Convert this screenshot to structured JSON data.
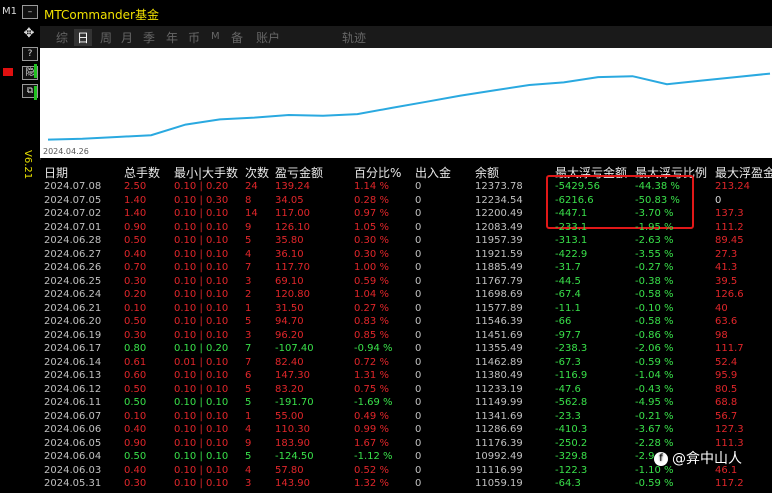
{
  "window": {
    "title": "MTCommander基金",
    "timeframe": "M1",
    "version": "V6.21"
  },
  "tabs": [
    {
      "label": "综"
    },
    {
      "label": "日",
      "active": true
    },
    {
      "label": "周"
    },
    {
      "label": "月"
    },
    {
      "label": "季"
    },
    {
      "label": "年"
    },
    {
      "label": "币"
    },
    {
      "label": "M"
    },
    {
      "label": "备"
    },
    {
      "label": "账户"
    },
    {
      "label": "轨迹"
    }
  ],
  "chart_data": {
    "type": "line",
    "start_label": "2024.04.26",
    "series": [
      {
        "values": [
          5,
          6,
          8,
          10,
          22,
          28,
          30,
          33,
          32,
          34,
          41,
          48,
          55,
          61,
          67,
          70,
          76,
          77,
          68,
          72,
          76,
          80
        ]
      }
    ],
    "ylim": [
      0,
      100
    ],
    "colors": {
      "line": "#2aa9e0"
    }
  },
  "table": {
    "headers": [
      "日期",
      "总手数",
      "最小|大手数",
      "次数",
      "盈亏金额",
      "百分比%",
      "出入金",
      "余额",
      "最大浮亏金额",
      "最大浮亏比例",
      "最大浮盈金额"
    ],
    "rows": [
      {
        "date": "2024.07.08",
        "lots": "2.50",
        "minmax": "0.10 | 0.20",
        "count": "24",
        "pl": "139.24",
        "pct": "1.14 %",
        "io": "0",
        "balance": "12373.78",
        "fl": "-5429.56",
        "flp": "-44.38 %",
        "fp": "213.24",
        "pos": true
      },
      {
        "date": "2024.07.05",
        "lots": "1.40",
        "minmax": "0.10 | 0.30",
        "count": "8",
        "pl": "34.05",
        "pct": "0.28 %",
        "io": "0",
        "balance": "12234.54",
        "fl": "-6216.6",
        "flp": "-50.83 %",
        "fp": "0",
        "pos": true
      },
      {
        "date": "2024.07.02",
        "lots": "1.40",
        "minmax": "0.10 | 0.10",
        "count": "14",
        "pl": "117.00",
        "pct": "0.97 %",
        "io": "0",
        "balance": "12200.49",
        "fl": "-447.1",
        "flp": "-3.70 %",
        "fp": "137.3",
        "pos": true
      },
      {
        "date": "2024.07.01",
        "lots": "0.90",
        "minmax": "0.10 | 0.10",
        "count": "9",
        "pl": "126.10",
        "pct": "1.05 %",
        "io": "0",
        "balance": "12083.49",
        "fl": "-233.1",
        "flp": "-1.95 %",
        "fp": "111.2",
        "pos": true
      },
      {
        "date": "2024.06.28",
        "lots": "0.50",
        "minmax": "0.10 | 0.10",
        "count": "5",
        "pl": "35.80",
        "pct": "0.30 %",
        "io": "0",
        "balance": "11957.39",
        "fl": "-313.1",
        "flp": "-2.63 %",
        "fp": "89.45",
        "pos": true
      },
      {
        "date": "2024.06.27",
        "lots": "0.40",
        "minmax": "0.10 | 0.10",
        "count": "4",
        "pl": "36.10",
        "pct": "0.30 %",
        "io": "0",
        "balance": "11921.59",
        "fl": "-422.9",
        "flp": "-3.55 %",
        "fp": "27.3",
        "pos": true
      },
      {
        "date": "2024.06.26",
        "lots": "0.70",
        "minmax": "0.10 | 0.10",
        "count": "7",
        "pl": "117.70",
        "pct": "1.00 %",
        "io": "0",
        "balance": "11885.49",
        "fl": "-31.7",
        "flp": "-0.27 %",
        "fp": "41.3",
        "pos": true
      },
      {
        "date": "2024.06.25",
        "lots": "0.30",
        "minmax": "0.10 | 0.10",
        "count": "3",
        "pl": "69.10",
        "pct": "0.59 %",
        "io": "0",
        "balance": "11767.79",
        "fl": "-44.5",
        "flp": "-0.38 %",
        "fp": "39.5",
        "pos": true
      },
      {
        "date": "2024.06.24",
        "lots": "0.20",
        "minmax": "0.10 | 0.10",
        "count": "2",
        "pl": "120.80",
        "pct": "1.04 %",
        "io": "0",
        "balance": "11698.69",
        "fl": "-67.4",
        "flp": "-0.58 %",
        "fp": "126.6",
        "pos": true
      },
      {
        "date": "2024.06.21",
        "lots": "0.10",
        "minmax": "0.10 | 0.10",
        "count": "1",
        "pl": "31.50",
        "pct": "0.27 %",
        "io": "0",
        "balance": "11577.89",
        "fl": "-11.1",
        "flp": "-0.10 %",
        "fp": "40",
        "pos": true
      },
      {
        "date": "2024.06.20",
        "lots": "0.50",
        "minmax": "0.10 | 0.10",
        "count": "5",
        "pl": "94.70",
        "pct": "0.83 %",
        "io": "0",
        "balance": "11546.39",
        "fl": "-66",
        "flp": "-0.58 %",
        "fp": "63.6",
        "pos": true
      },
      {
        "date": "2024.06.19",
        "lots": "0.30",
        "minmax": "0.10 | 0.10",
        "count": "3",
        "pl": "96.20",
        "pct": "0.85 %",
        "io": "0",
        "balance": "11451.69",
        "fl": "-97.7",
        "flp": "-0.86 %",
        "fp": "98",
        "pos": true
      },
      {
        "date": "2024.06.17",
        "lots": "0.80",
        "minmax": "0.10 | 0.20",
        "count": "7",
        "pl": "-107.40",
        "pct": "-0.94 %",
        "io": "0",
        "balance": "11355.49",
        "fl": "-238.3",
        "flp": "-2.06 %",
        "fp": "111.7",
        "pos": false
      },
      {
        "date": "2024.06.14",
        "lots": "0.61",
        "minmax": "0.01 | 0.10",
        "count": "7",
        "pl": "82.40",
        "pct": "0.72 %",
        "io": "0",
        "balance": "11462.89",
        "fl": "-67.3",
        "flp": "-0.59 %",
        "fp": "52.4",
        "pos": true
      },
      {
        "date": "2024.06.13",
        "lots": "0.60",
        "minmax": "0.10 | 0.10",
        "count": "6",
        "pl": "147.30",
        "pct": "1.31 %",
        "io": "0",
        "balance": "11380.49",
        "fl": "-116.9",
        "flp": "-1.04 %",
        "fp": "95.9",
        "pos": true
      },
      {
        "date": "2024.06.12",
        "lots": "0.50",
        "minmax": "0.10 | 0.10",
        "count": "5",
        "pl": "83.20",
        "pct": "0.75 %",
        "io": "0",
        "balance": "11233.19",
        "fl": "-47.6",
        "flp": "-0.43 %",
        "fp": "80.5",
        "pos": true
      },
      {
        "date": "2024.06.11",
        "lots": "0.50",
        "minmax": "0.10 | 0.10",
        "count": "5",
        "pl": "-191.70",
        "pct": "-1.69 %",
        "io": "0",
        "balance": "11149.99",
        "fl": "-562.8",
        "flp": "-4.95 %",
        "fp": "68.8",
        "pos": false
      },
      {
        "date": "2024.06.07",
        "lots": "0.10",
        "minmax": "0.10 | 0.10",
        "count": "1",
        "pl": "55.00",
        "pct": "0.49 %",
        "io": "0",
        "balance": "11341.69",
        "fl": "-23.3",
        "flp": "-0.21 %",
        "fp": "56.7",
        "pos": true
      },
      {
        "date": "2024.06.06",
        "lots": "0.40",
        "minmax": "0.10 | 0.10",
        "count": "4",
        "pl": "110.30",
        "pct": "0.99 %",
        "io": "0",
        "balance": "11286.69",
        "fl": "-410.3",
        "flp": "-3.67 %",
        "fp": "127.3",
        "pos": true
      },
      {
        "date": "2024.06.05",
        "lots": "0.90",
        "minmax": "0.10 | 0.10",
        "count": "9",
        "pl": "183.90",
        "pct": "1.67 %",
        "io": "0",
        "balance": "11176.39",
        "fl": "-250.2",
        "flp": "-2.28 %",
        "fp": "111.3",
        "pos": true
      },
      {
        "date": "2024.06.04",
        "lots": "0.50",
        "minmax": "0.10 | 0.10",
        "count": "5",
        "pl": "-124.50",
        "pct": "-1.12 %",
        "io": "0",
        "balance": "10992.49",
        "fl": "-329.8",
        "flp": "-2.9",
        "fp": "",
        "pos": false
      },
      {
        "date": "2024.06.03",
        "lots": "0.40",
        "minmax": "0.10 | 0.10",
        "count": "4",
        "pl": "57.80",
        "pct": "0.52 %",
        "io": "0",
        "balance": "11116.99",
        "fl": "-122.3",
        "flp": "-1.10 %",
        "fp": "46.1",
        "pos": true
      },
      {
        "date": "2024.05.31",
        "lots": "0.30",
        "minmax": "0.10 | 0.10",
        "count": "3",
        "pl": "143.90",
        "pct": "1.32 %",
        "io": "0",
        "balance": "11059.19",
        "fl": "-64.3",
        "flp": "-0.59 %",
        "fp": "117.2",
        "pos": true
      }
    ]
  },
  "watermark": {
    "text": "@弇中山人"
  }
}
